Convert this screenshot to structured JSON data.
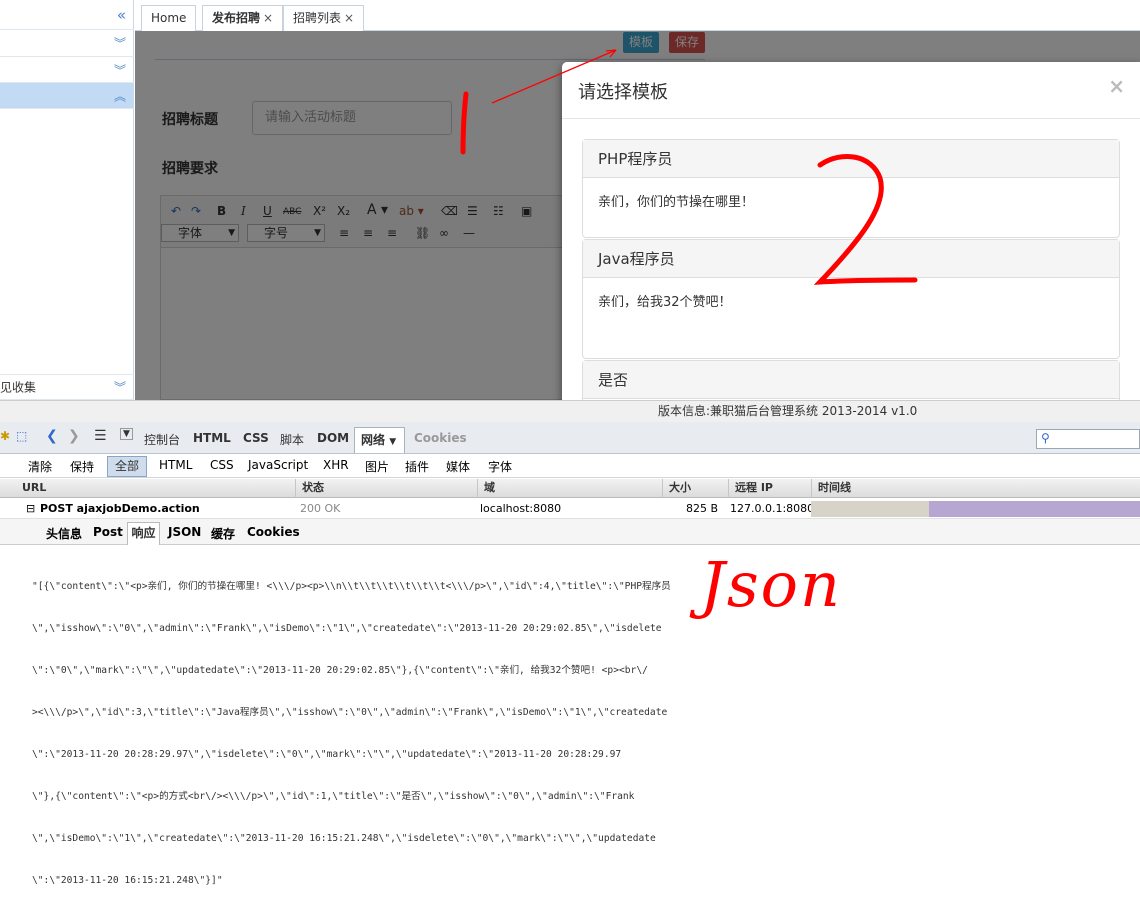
{
  "sidebar": {
    "collapse_icon": "double-chevron-left-icon",
    "bottom_label": "见收集"
  },
  "tabs": [
    {
      "label": "Home",
      "closable": false
    },
    {
      "label": "发布招聘",
      "closable": true,
      "active": true
    },
    {
      "label": "招聘列表",
      "closable": true
    }
  ],
  "toolbar": {
    "template_label": "模板",
    "save_label": "保存"
  },
  "form": {
    "title_label": "招聘标题",
    "title_placeholder": "请输入活动标题",
    "requirements_label": "招聘要求",
    "font_select": "字体",
    "size_select": "字号"
  },
  "modal": {
    "title": "请选择模板",
    "close": "×",
    "templates": [
      {
        "title": "PHP程序员",
        "body": "亲们，你们的节操在哪里！"
      },
      {
        "title": "Java程序员",
        "body": "亲们，给我32个赞吧！"
      },
      {
        "title": "是否",
        "body": ""
      }
    ]
  },
  "footer": {
    "version_text": "版本信息:兼职猫后台管理系统 2013-2014 v1.0"
  },
  "devtools": {
    "main_tabs": [
      "控制台",
      "HTML",
      "CSS",
      "脚本",
      "DOM",
      "网络",
      "Cookies"
    ],
    "active_tab": "网络",
    "filters": {
      "clear": "清除",
      "persist": "保持",
      "all": "全部",
      "types": [
        "HTML",
        "CSS",
        "JavaScript",
        "XHR",
        "图片",
        "插件",
        "媒体",
        "字体"
      ]
    },
    "columns": [
      "URL",
      "状态",
      "域",
      "大小",
      "远程 IP",
      "时间线"
    ],
    "request": {
      "expand": "⊟",
      "url": "POST ajaxjobDemo.action",
      "status": "200 OK",
      "domain": "localhost:8080",
      "size": "825 B",
      "remote_ip": "127.0.0.1:8080",
      "timeline_fraction": 0.35
    },
    "sub_tabs": [
      "头信息",
      "Post",
      "响应",
      "JSON",
      "缓存",
      "Cookies"
    ],
    "active_sub_tab": "响应",
    "response_lines": [
      "\"[{\\\"content\\\":\\\"<p>亲们, 你们的节操在哪里! <\\\\\\/p><p>\\\\n\\\\t\\\\t\\\\t\\\\t\\\\t\\\\t<\\\\\\/p>\\\",\\\"id\\\":4,\\\"title\\\":\\\"PHP程序员",
      "\\\",\\\"isshow\\\":\\\"0\\\",\\\"admin\\\":\\\"Frank\\\",\\\"isDemo\\\":\\\"1\\\",\\\"createdate\\\":\\\"2013-11-20 20:29:02.85\\\",\\\"isdelete",
      "\\\":\\\"0\\\",\\\"mark\\\":\\\"\\\",\\\"updatedate\\\":\\\"2013-11-20 20:29:02.85\\\"},{\\\"content\\\":\\\"亲们, 给我32个赞吧! <p><br\\/",
      "><\\\\\\/p>\\\",\\\"id\\\":3,\\\"title\\\":\\\"Java程序员\\\",\\\"isshow\\\":\\\"0\\\",\\\"admin\\\":\\\"Frank\\\",\\\"isDemo\\\":\\\"1\\\",\\\"createdate",
      "\\\":\\\"2013-11-20 20:28:29.97\\\",\\\"isdelete\\\":\\\"0\\\",\\\"mark\\\":\\\"\\\",\\\"updatedate\\\":\\\"2013-11-20 20:28:29.97",
      "\\\"},{\\\"content\\\":\\\"<p>的方式<br\\/><\\\\\\/p>\\\",\\\"id\\\":1,\\\"title\\\":\\\"是否\\\",\\\"isshow\\\":\\\"0\\\",\\\"admin\\\":\\\"Frank",
      "\\\",\\\"isDemo\\\":\\\"1\\\",\\\"createdate\\\":\\\"2013-11-20 16:15:21.248\\\",\\\"isdelete\\\":\\\"0\\\",\\\"mark\\\":\\\"\\\",\\\"updatedate",
      "\\\":\\\"2013-11-20 16:15:21.248\\\"}]\""
    ]
  },
  "annotations": {
    "label_1": "1",
    "label_2": "2",
    "json_label": "Json",
    "color": "#ff0000"
  }
}
